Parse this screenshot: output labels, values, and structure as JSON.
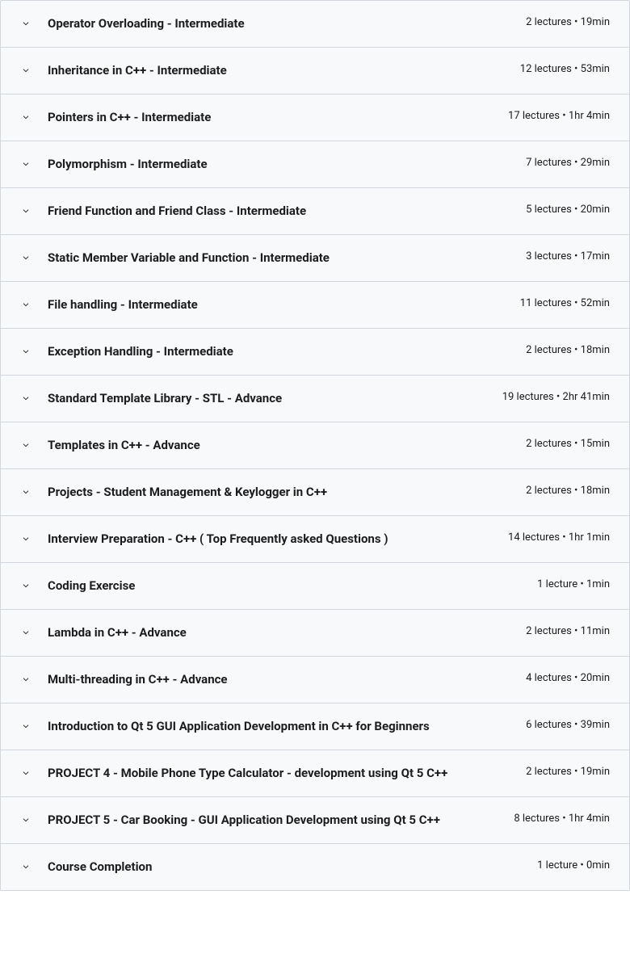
{
  "sections": [
    {
      "title": "Operator Overloading - Intermediate",
      "meta": "2 lectures • 19min"
    },
    {
      "title": "Inheritance in C++ - Intermediate",
      "meta": "12 lectures • 53min"
    },
    {
      "title": "Pointers in C++ - Intermediate",
      "meta": "17 lectures • 1hr 4min"
    },
    {
      "title": "Polymorphism - Intermediate",
      "meta": "7 lectures • 29min"
    },
    {
      "title": "Friend Function and Friend Class - Intermediate",
      "meta": "5 lectures • 20min"
    },
    {
      "title": "Static Member Variable and Function - Intermediate",
      "meta": "3 lectures • 17min"
    },
    {
      "title": "File handling - Intermediate",
      "meta": "11 lectures • 52min"
    },
    {
      "title": "Exception Handling - Intermediate",
      "meta": "2 lectures • 18min"
    },
    {
      "title": "Standard Template Library - STL - Advance",
      "meta": "19 lectures • 2hr 41min"
    },
    {
      "title": "Templates in C++ - Advance",
      "meta": "2 lectures • 15min"
    },
    {
      "title": "Projects - Student Management & Keylogger in C++",
      "meta": "2 lectures • 18min"
    },
    {
      "title": "Interview Preparation - C++ ( Top Frequently asked Questions )",
      "meta": "14 lectures • 1hr 1min"
    },
    {
      "title": "Coding Exercise",
      "meta": "1 lecture • 1min"
    },
    {
      "title": "Lambda in C++ - Advance",
      "meta": "2 lectures • 11min"
    },
    {
      "title": "Multi-threading in C++ - Advance",
      "meta": "4 lectures • 20min"
    },
    {
      "title": "Introduction to Qt 5 GUI Application Development in C++ for Beginners",
      "meta": "6 lectures • 39min"
    },
    {
      "title": "PROJECT 4 - Mobile Phone Type Calculator - development using Qt 5 C++",
      "meta": "2 lectures • 19min"
    },
    {
      "title": "PROJECT 5 - Car Booking - GUI Application Development using Qt 5 C++",
      "meta": "8 lectures • 1hr 4min"
    },
    {
      "title": "Course Completion",
      "meta": "1 lecture • 0min"
    }
  ]
}
